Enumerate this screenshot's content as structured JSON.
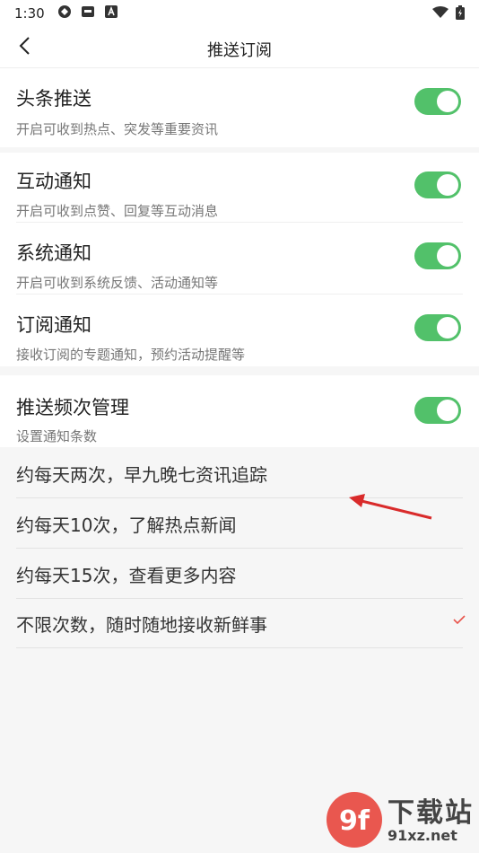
{
  "status_bar": {
    "time": "1:30",
    "icons": [
      "app-icon-1",
      "app-icon-2",
      "app-icon-a"
    ],
    "right_icons": [
      "wifi-icon",
      "battery-icon"
    ]
  },
  "header": {
    "title": "推送订阅",
    "back_icon": "back-arrow-icon"
  },
  "settings": [
    {
      "title": "头条推送",
      "subtitle": "开启可收到热点、突发等重要资讯",
      "enabled": true
    },
    {
      "title": "互动通知",
      "subtitle": "开启可收到点赞、回复等互动消息",
      "enabled": true
    },
    {
      "title": "系统通知",
      "subtitle": "开启可收到系统反馈、活动通知等",
      "enabled": true
    },
    {
      "title": "订阅通知",
      "subtitle": "接收订阅的专题通知，预约活动提醒等",
      "enabled": true
    },
    {
      "title": "推送频次管理",
      "subtitle": "设置通知条数",
      "enabled": true
    }
  ],
  "frequency_options": [
    {
      "label": "约每天两次，早九晚七资讯追踪",
      "selected": false
    },
    {
      "label": "约每天10次，了解热点新闻",
      "selected": false
    },
    {
      "label": "约每天15次，查看更多内容",
      "selected": false
    },
    {
      "label": "不限次数，随时随地接收新鲜事",
      "selected": true
    }
  ],
  "colors": {
    "toggle_on": "#52c16a",
    "check": "#e8534a",
    "annotation_arrow": "#d92b2b"
  },
  "watermark": {
    "logo_text": "9f",
    "big_text": "下载站",
    "small_text": "91xz.net"
  }
}
